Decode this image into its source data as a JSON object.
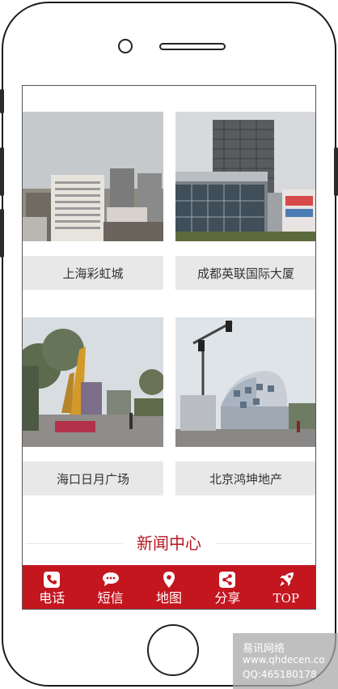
{
  "projects": [
    {
      "caption": "上海彩虹城",
      "image": "building-photo"
    },
    {
      "caption": "成都英联国际大厦",
      "image": "building-photo"
    },
    {
      "caption": "海口日月广场",
      "image": "plaza-photo"
    },
    {
      "caption": "北京鸿坤地产",
      "image": "building-photo"
    }
  ],
  "news": {
    "title": "新闻中心"
  },
  "nav": [
    {
      "label": "电话",
      "icon": "phone-icon"
    },
    {
      "label": "短信",
      "icon": "chat-icon"
    },
    {
      "label": "地图",
      "icon": "map-pin-icon"
    },
    {
      "label": "分享",
      "icon": "share-icon"
    },
    {
      "label": "TOP",
      "icon": "rocket-icon"
    }
  ],
  "watermark": {
    "name": "易讯网络",
    "site": "www.qhdecen.co",
    "qq": "QQ:465180178"
  },
  "colors": {
    "brand_red": "#c4161f",
    "caption_bg": "#e8e8e8"
  }
}
